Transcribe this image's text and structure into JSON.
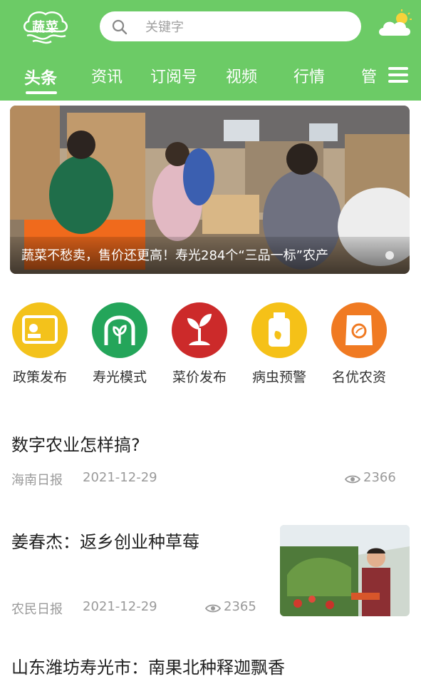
{
  "app": {
    "logo_text": "蔬菜"
  },
  "search": {
    "placeholder": "关键字"
  },
  "tabs": [
    {
      "label": "头条",
      "active": true
    },
    {
      "label": "资讯"
    },
    {
      "label": "订阅号"
    },
    {
      "label": "视频"
    },
    {
      "label": "行情"
    },
    {
      "label": "管"
    }
  ],
  "banner": {
    "caption": "蔬菜不愁卖，售价还更高！寿光284个“三品一标”农产"
  },
  "quick_links": [
    {
      "label": "政策发布",
      "icon": "policy-board-icon",
      "color": "#f3c21b"
    },
    {
      "label": "寿光模式",
      "icon": "greenhouse-sprout-icon",
      "color": "#24a55a"
    },
    {
      "label": "菜价发布",
      "icon": "seedling-price-icon",
      "color": "#cc2a2a"
    },
    {
      "label": "病虫预警",
      "icon": "pesticide-bottle-icon",
      "color": "#f5c118"
    },
    {
      "label": "名优农资",
      "icon": "fertilizer-bag-icon",
      "color": "#f07a22"
    }
  ],
  "news": [
    {
      "title": "数字农业怎样搞?",
      "source": "海南日报",
      "date": "2021-12-29",
      "views": "2366"
    },
    {
      "title": "姜春杰：返乡创业种草莓",
      "source": "农民日报",
      "date": "2021-12-29",
      "views": "2365"
    },
    {
      "title": "山东潍坊寿光市：南果北种释迦飘香"
    }
  ],
  "colors": {
    "header_green": "#6ccb66",
    "meta_gray": "#9a9a9a"
  }
}
